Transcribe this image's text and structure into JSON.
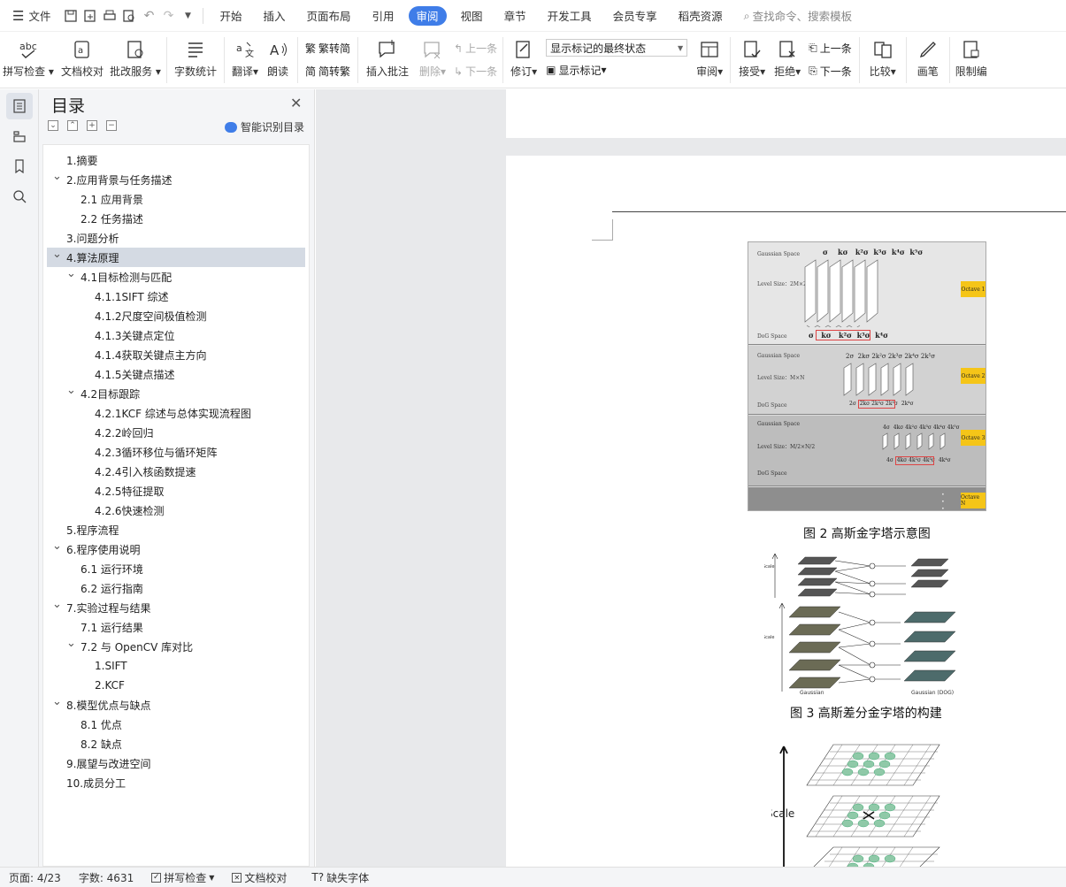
{
  "menu": {
    "file": "文件",
    "tabs": [
      "开始",
      "插入",
      "页面布局",
      "引用",
      "审阅",
      "视图",
      "章节",
      "开发工具",
      "会员专享",
      "稻壳资源"
    ],
    "active_tab": "审阅",
    "search": "查找命令、搜索模板"
  },
  "ribbon": {
    "spell": "拼写检查",
    "doc_check": "文档校对",
    "annotate": "批改服务",
    "word_count": "字数统计",
    "translate": "翻译",
    "read_aloud": "朗读",
    "trad": "繁转简",
    "simp": "简转繁",
    "insert_comment": "插入批注",
    "delete": "删除",
    "prev": "上一条",
    "next": "下一条",
    "track": "修订",
    "markup_state": "显示标记的最终状态",
    "show_markup": "显示标记",
    "review": "审阅",
    "accept": "接受",
    "reject": "拒绝",
    "prev2": "上一条",
    "next2": "下一条",
    "compare": "比较",
    "pen": "画笔",
    "restrict": "限制编"
  },
  "toc": {
    "title": "目录",
    "smart": "智能识别目录",
    "items": [
      {
        "text": "1.摘要",
        "level": 1,
        "arrow": false
      },
      {
        "text": "2.应用背景与任务描述",
        "level": 1,
        "arrow": true
      },
      {
        "text": "2.1 应用背景",
        "level": 2,
        "arrow": false
      },
      {
        "text": "2.2 任务描述",
        "level": 2,
        "arrow": false
      },
      {
        "text": "3.问题分析",
        "level": 1,
        "arrow": false
      },
      {
        "text": "4.算法原理",
        "level": 1,
        "arrow": true,
        "selected": true
      },
      {
        "text": "4.1目标检测与匹配",
        "level": 2,
        "arrow": true
      },
      {
        "text": "4.1.1SIFT 综述",
        "level": 3,
        "arrow": false
      },
      {
        "text": "4.1.2尺度空间极值检测",
        "level": 3,
        "arrow": false
      },
      {
        "text": "4.1.3关键点定位",
        "level": 3,
        "arrow": false
      },
      {
        "text": "4.1.4获取关键点主方向",
        "level": 3,
        "arrow": false
      },
      {
        "text": "4.1.5关键点描述",
        "level": 3,
        "arrow": false
      },
      {
        "text": "4.2目标跟踪",
        "level": 2,
        "arrow": true
      },
      {
        "text": "4.2.1KCF 综述与总体实现流程图",
        "level": 3,
        "arrow": false
      },
      {
        "text": "4.2.2岭回归",
        "level": 3,
        "arrow": false
      },
      {
        "text": "4.2.3循环移位与循环矩阵",
        "level": 3,
        "arrow": false
      },
      {
        "text": "4.2.4引入核函数提速",
        "level": 3,
        "arrow": false
      },
      {
        "text": "4.2.5特征提取",
        "level": 3,
        "arrow": false
      },
      {
        "text": "4.2.6快速检测",
        "level": 3,
        "arrow": false
      },
      {
        "text": "5.程序流程",
        "level": 1,
        "arrow": false
      },
      {
        "text": "6.程序使用说明",
        "level": 1,
        "arrow": true
      },
      {
        "text": "6.1 运行环境",
        "level": 2,
        "arrow": false
      },
      {
        "text": "6.2 运行指南",
        "level": 2,
        "arrow": false
      },
      {
        "text": "7.实验过程与结果",
        "level": 1,
        "arrow": true
      },
      {
        "text": "7.1 运行结果",
        "level": 2,
        "arrow": false
      },
      {
        "text": "7.2 与 OpenCV 库对比",
        "level": 2,
        "arrow": true
      },
      {
        "text": "1.SIFT",
        "level": 3,
        "arrow": false
      },
      {
        "text": "2.KCF",
        "level": 3,
        "arrow": false
      },
      {
        "text": "8.模型优点与缺点",
        "level": 1,
        "arrow": true
      },
      {
        "text": "8.1 优点",
        "level": 2,
        "arrow": false
      },
      {
        "text": "8.2 缺点",
        "level": 2,
        "arrow": false
      },
      {
        "text": "9.展望与改进空间",
        "level": 1,
        "arrow": false
      },
      {
        "text": "10.成员分工",
        "level": 1,
        "arrow": false
      }
    ]
  },
  "document": {
    "fig2": {
      "caption": "图 2 高斯金字塔示意图",
      "gauss_space": "Gaussian Space",
      "dog_space": "DoG Space",
      "level1": "Level Size：2M×2N",
      "level2": "Level Size：M×N",
      "level3": "Level Size：M/2×N/2",
      "sig1": "σ    kσ   k²σ  k³σ  k⁴σ  k⁵σ",
      "dog1": "σ   kσ   k²σ  k³σ  k⁴σ",
      "sig2": "2σ  2kσ 2k²σ 2k³σ 2k⁴σ 2k⁵σ",
      "dog2": "2σ  2kσ 2k²σ 2k³σ  2k⁴σ",
      "sig3": "4σ  4kσ 4k²σ 4k³σ 4k⁴σ 4k⁵σ",
      "dog3": "4σ  4kσ 4k²σ 4k³σ  4k⁴σ",
      "octave1": "Octave 1",
      "octave2": "Octave 2",
      "octave3": "Octave 3",
      "octaveN": "Octave N"
    },
    "fig3": {
      "caption": "图 3 高斯差分金字塔的构建",
      "scale_next": "Scale\n(next\noctave)",
      "scale_first": "Scale\n(first\noctave)",
      "gaussian": "Gaussian",
      "dog": "Difference of\nGaussian (DOG)"
    },
    "fig4": {
      "scale": "Scale"
    }
  },
  "status": {
    "page": "页面: 4/23",
    "words": "字数: 4631",
    "spell": "拼写检查",
    "doc_check": "文档校对",
    "missing_font": "缺失字体"
  },
  "colors": {
    "accent": "#3f7de8",
    "octave": "#f5c518"
  }
}
